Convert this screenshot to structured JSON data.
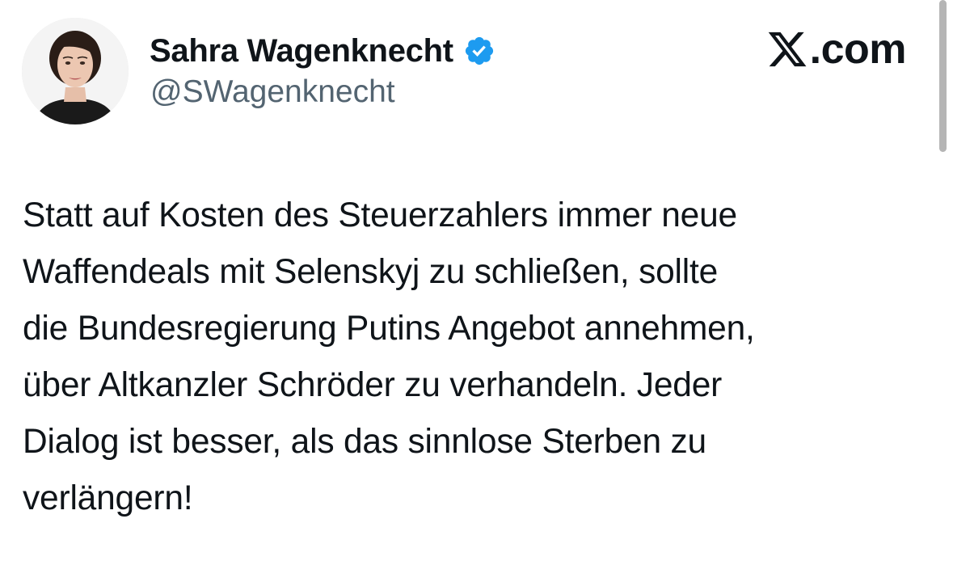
{
  "author": {
    "display_name": "Sahra Wagenknecht",
    "handle": "@SWagenknecht",
    "verified": true
  },
  "brand": {
    "text": ".com",
    "icon": "x-logo-icon"
  },
  "tweet": {
    "lines": [
      "Statt auf Kosten des Steuerzahlers immer neue",
      "Waffendeals mit Selenskyj zu schließen, sollte",
      "die Bundesregierung Putins Angebot annehmen,",
      "über Altkanzler Schröder zu verhandeln. Jeder",
      "Dialog ist besser, als das sinnlose Sterben zu",
      "verlängern!"
    ]
  },
  "colors": {
    "text": "#0f1419",
    "secondary": "#536471",
    "verified": "#1d9bf0",
    "background": "#ffffff"
  }
}
